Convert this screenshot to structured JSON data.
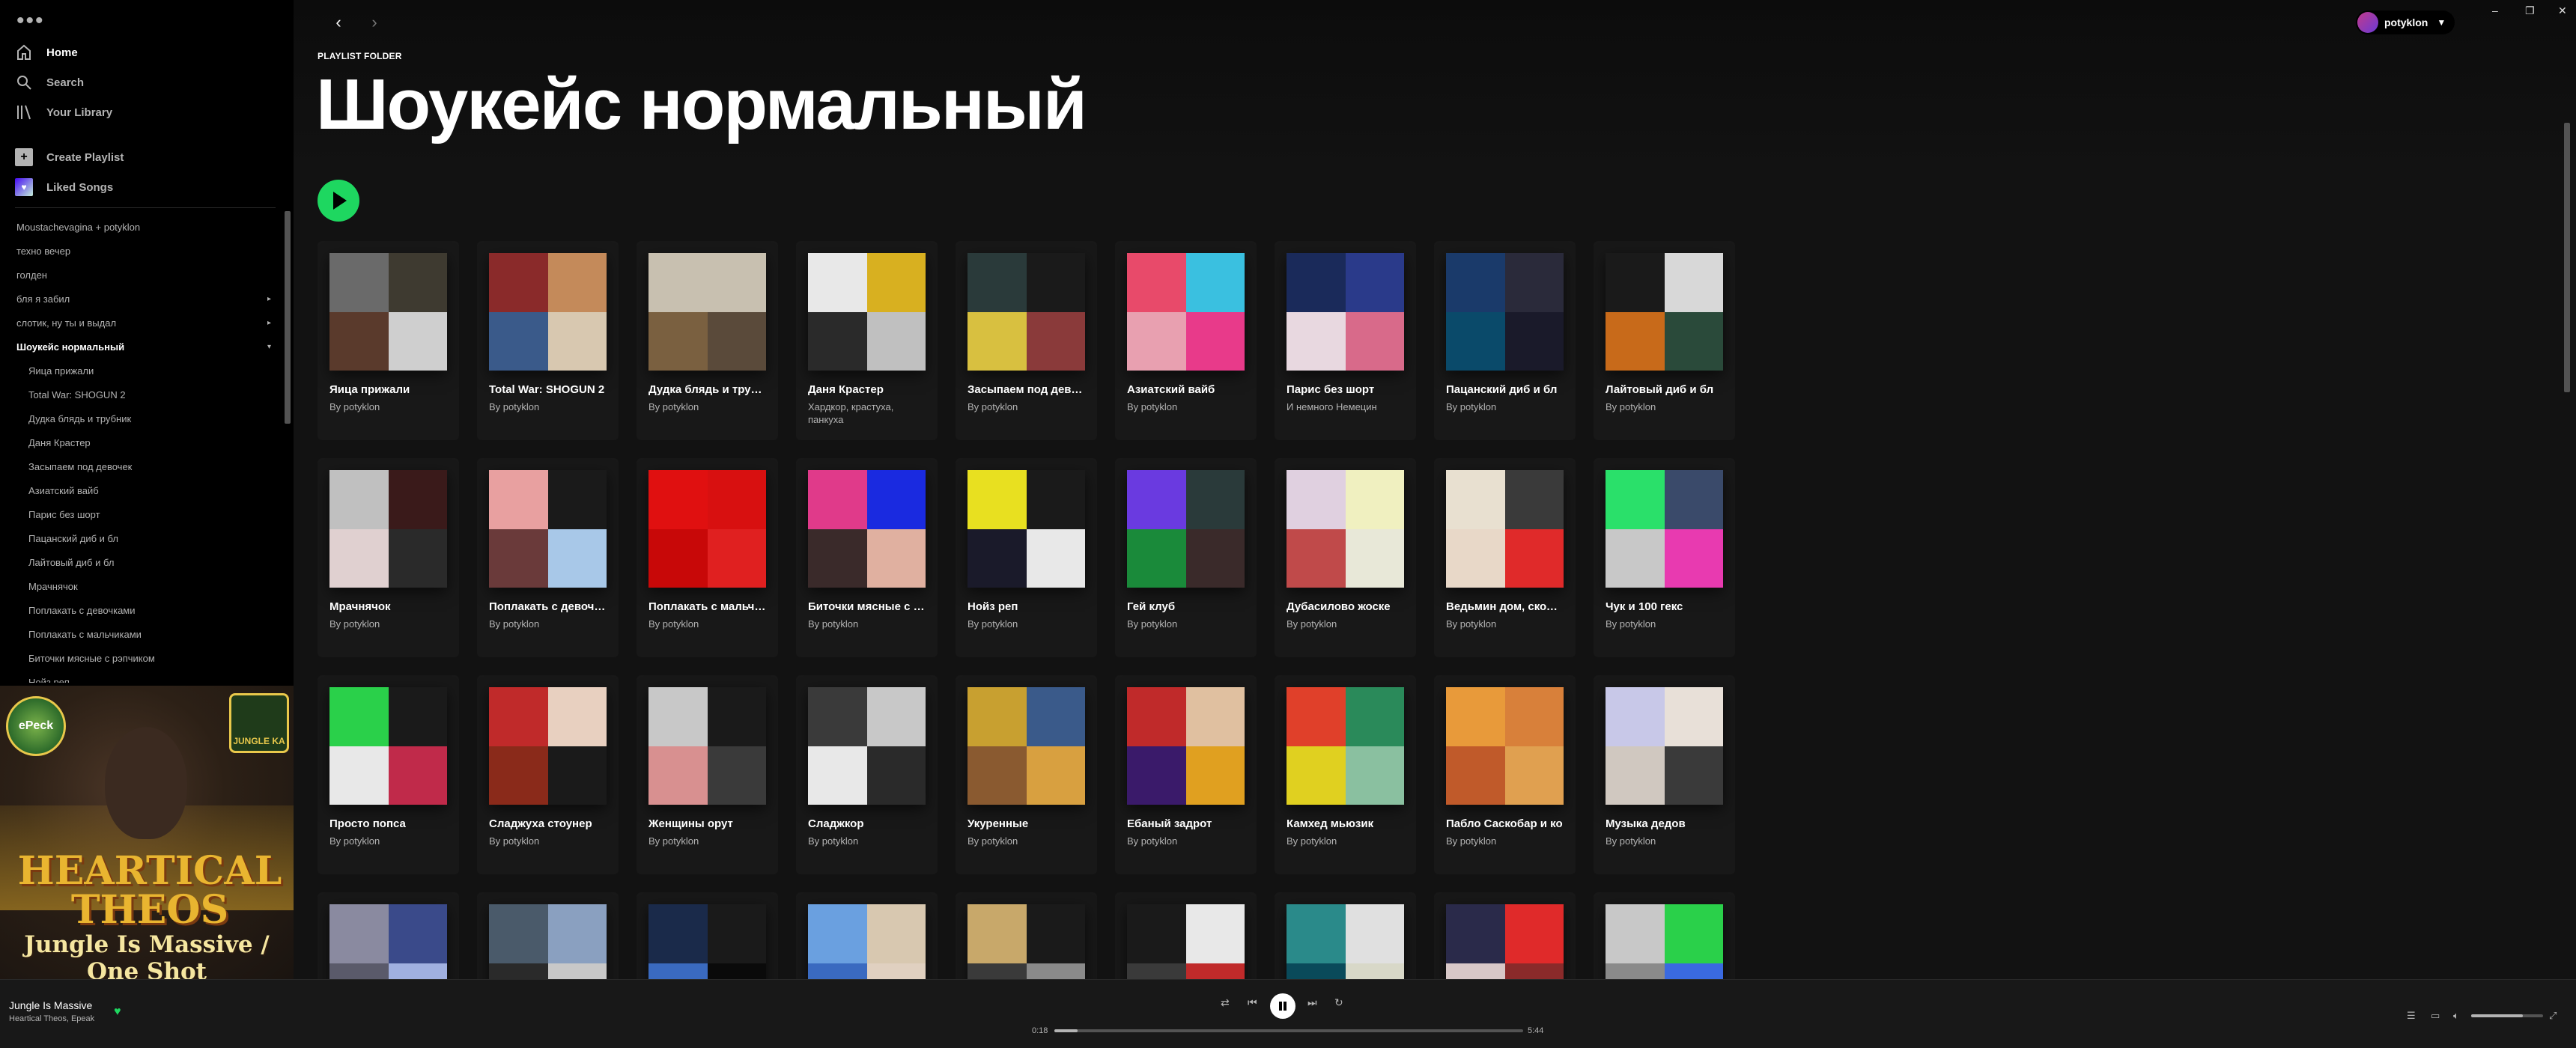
{
  "window": {
    "minimize": "–",
    "maximize": "❐",
    "close": "✕"
  },
  "sidebar": {
    "menu_icon": "•••",
    "nav": [
      {
        "label": "Home",
        "icon": "home-icon"
      },
      {
        "label": "Search",
        "icon": "search-icon"
      },
      {
        "label": "Your Library",
        "icon": "library-icon"
      }
    ],
    "create_playlist": "Create Playlist",
    "liked_songs": "Liked Songs",
    "playlists": [
      {
        "label": "Moustachevagina + potyklon",
        "level": 0
      },
      {
        "label": "техно вечер",
        "level": 0
      },
      {
        "label": "голден",
        "level": 0
      },
      {
        "label": "бля я забил",
        "level": 0,
        "caret": "▸"
      },
      {
        "label": "слотик, ну ты и выдал",
        "level": 0,
        "caret": "▸"
      },
      {
        "label": "Шоукейс нормальный",
        "level": 0,
        "caret": "▾",
        "open": true
      },
      {
        "label": "Яица прижали",
        "level": 1
      },
      {
        "label": "Total War: SHOGUN 2",
        "level": 1
      },
      {
        "label": "Дудка блядь и трубник",
        "level": 1
      },
      {
        "label": "Даня Крастер",
        "level": 1
      },
      {
        "label": "Засыпаем под девочек",
        "level": 1
      },
      {
        "label": "Азиатский вайб",
        "level": 1
      },
      {
        "label": "Парис без шорт",
        "level": 1
      },
      {
        "label": "Пацанский диб и бл",
        "level": 1
      },
      {
        "label": "Лайтовый диб и бл",
        "level": 1
      },
      {
        "label": "Мрачнячок",
        "level": 1
      },
      {
        "label": "Поплакать с девочками",
        "level": 1
      },
      {
        "label": "Поплакать с мальчиками",
        "level": 1
      },
      {
        "label": "Биточки мясные с рэпчиком",
        "level": 1
      },
      {
        "label": "Нойз реп",
        "level": 1
      }
    ],
    "album_art": {
      "logo_left": "ePeck",
      "logo_right": "JUNGLE KA",
      "title": "HEARTICAL THEOS",
      "subtitle": "Jungle Is Massive / One Shot"
    }
  },
  "topbar": {
    "back": "‹",
    "forward": "›",
    "user": "potyklon",
    "chevron": "▼"
  },
  "header": {
    "kind": "PLAYLIST FOLDER",
    "title": "Шоукейс нормальный"
  },
  "cards": [
    {
      "title": "Яица прижали",
      "sub": "By potyklon",
      "colors": [
        "#6a6a6a",
        "#3e3a30",
        "#5a3a2c",
        "#cfcfcf"
      ]
    },
    {
      "title": "Total War: SHOGUN 2",
      "sub": "By potyklon",
      "colors": [
        "#8a2a2a",
        "#c48a5a",
        "#3a5a8a",
        "#d8c8b0"
      ]
    },
    {
      "title": "Дудка блядь и трубник",
      "sub": "By potyklon",
      "colors": [
        "#c8c0b0",
        "#c8c0b0",
        "#7a6040",
        "#5a4a3a"
      ]
    },
    {
      "title": "Даня Крастер",
      "sub": "Хардкор, крастуха, панкуха",
      "colors": [
        "#e8e8e8",
        "#d8b020",
        "#2a2a2a",
        "#c0c0c0"
      ]
    },
    {
      "title": "Засыпаем под девочек",
      "sub": "By potyklon",
      "colors": [
        "#2a3a3a",
        "#1a1a1a",
        "#d8c040",
        "#8a3a3a"
      ]
    },
    {
      "title": "Азиатский вайб",
      "sub": "By potyklon",
      "colors": [
        "#e84a6a",
        "#3ac0e0",
        "#e8a0b0",
        "#e83a8a"
      ]
    },
    {
      "title": "Парис без шорт",
      "sub": "И немного Немецин",
      "colors": [
        "#1a2a5a",
        "#2a3a8a",
        "#e8d8e0",
        "#d86a8a"
      ]
    },
    {
      "title": "Пацанский диб и бл",
      "sub": "By potyklon",
      "colors": [
        "#1a3a6a",
        "#2a2a3a",
        "#0a4a6a",
        "#1a1a2a"
      ]
    },
    {
      "title": "Лайтовый диб и бл",
      "sub": "By potyklon",
      "colors": [
        "#1a1a1a",
        "#d8d8d8",
        "#c86a1a",
        "#2a4a3a"
      ]
    },
    {
      "title": "Мрачнячок",
      "sub": "By potyklon",
      "colors": [
        "#c0c0c0",
        "#3a1a1a",
        "#e0d0d0",
        "#2a2a2a"
      ]
    },
    {
      "title": "Поплакать с девочками",
      "sub": "By potyklon",
      "colors": [
        "#e8a0a0",
        "#1a1a1a",
        "#6a3a3a",
        "#a8c8e8"
      ]
    },
    {
      "title": "Поплакать с мальчиками",
      "sub": "By potyklon",
      "colors": [
        "#e01010",
        "#d81010",
        "#c80808",
        "#e02020"
      ]
    },
    {
      "title": "Биточки мясные с рэпчиком",
      "sub": "By potyklon",
      "colors": [
        "#e03a8a",
        "#1a2ae0",
        "#3a2a2a",
        "#e0b0a0"
      ]
    },
    {
      "title": "Нойз реп",
      "sub": "By potyklon",
      "colors": [
        "#e8e020",
        "#1a1a1a",
        "#1a1a2a",
        "#e8e8e8"
      ]
    },
    {
      "title": "Гей клуб",
      "sub": "By potyklon",
      "colors": [
        "#6a3ae0",
        "#2a3a3a",
        "#1a8a3a",
        "#3a2a2a"
      ]
    },
    {
      "title": "Дубасилово жоске",
      "sub": "By potyklon",
      "colors": [
        "#e0d0e0",
        "#f0f0c0",
        "#c04a4a",
        "#e8e8d8"
      ]
    },
    {
      "title": "Ведьмин дом, сколько лет",
      "sub": "By potyklon",
      "colors": [
        "#e8e0d0",
        "#3a3a3a",
        "#e8d8c8",
        "#e02a2a"
      ]
    },
    {
      "title": "Чук и 100 гекс",
      "sub": "By potyklon",
      "colors": [
        "#2ae06a",
        "#3a4a6a",
        "#c8c8c8",
        "#e83ab0"
      ]
    },
    {
      "title": "Просто попса",
      "sub": "By potyklon",
      "colors": [
        "#2ad04a",
        "#1a1a1a",
        "#e8e8e8",
        "#c02a4a"
      ]
    },
    {
      "title": "Сладжуха стоунер",
      "sub": "By potyklon",
      "colors": [
        "#c02a2a",
        "#e8d0c0",
        "#8a2a1a",
        "#1a1a1a"
      ]
    },
    {
      "title": "Женщины орут",
      "sub": "By potyklon",
      "colors": [
        "#c8c8c8",
        "#1a1a1a",
        "#d89090",
        "#3a3a3a"
      ]
    },
    {
      "title": "Сладжкор",
      "sub": "By potyklon",
      "colors": [
        "#3a3a3a",
        "#c8c8c8",
        "#e8e8e8",
        "#2a2a2a"
      ]
    },
    {
      "title": "Укуренные",
      "sub": "By potyklon",
      "colors": [
        "#c8a030",
        "#3a5a8a",
        "#8a5a30",
        "#d8a040"
      ]
    },
    {
      "title": "Ебаный задрот",
      "sub": "By potyklon",
      "colors": [
        "#c02a2a",
        "#e0c0a0",
        "#3a1a6a",
        "#e0a020"
      ]
    },
    {
      "title": "Камхед мьюзик",
      "sub": "By potyklon",
      "colors": [
        "#e0402a",
        "#2a8a5a",
        "#e0d020",
        "#8ac0a0"
      ]
    },
    {
      "title": "Пабло Саскобар и ко",
      "sub": "By potyklon",
      "colors": [
        "#e89a3a",
        "#d8803a",
        "#c05a2a",
        "#e0a050"
      ]
    },
    {
      "title": "Музыка дедов",
      "sub": "By potyklon",
      "colors": [
        "#c8c8e8",
        "#e8e0d8",
        "#d0c8c0",
        "#3a3a3a"
      ]
    },
    {
      "title": "",
      "sub": "",
      "colors": [
        "#8a8aa0",
        "#3a4a8a",
        "#5a5a6a",
        "#a0b0e0"
      ]
    },
    {
      "title": "",
      "sub": "",
      "colors": [
        "#4a5a6a",
        "#8aa0c0",
        "#2a2a2a",
        "#c8c8c8"
      ]
    },
    {
      "title": "",
      "sub": "",
      "colors": [
        "#1a2a4a",
        "#1a1a1a",
        "#3a6ac0",
        "#0a0a0a"
      ]
    },
    {
      "title": "",
      "sub": "",
      "colors": [
        "#6aa0e0",
        "#d8c8b0",
        "#3a6ac0",
        "#e0d0c0"
      ]
    },
    {
      "title": "",
      "sub": "",
      "colors": [
        "#c8a86a",
        "#1a1a1a",
        "#3a3a3a",
        "#8a8a8a"
      ]
    },
    {
      "title": "",
      "sub": "",
      "colors": [
        "#1a1a1a",
        "#e8e8e8",
        "#3a3a3a",
        "#c02a2a"
      ]
    },
    {
      "title": "",
      "sub": "",
      "colors": [
        "#2a8a8a",
        "#e0e0e0",
        "#0a4a5a",
        "#d8d8c8"
      ]
    },
    {
      "title": "",
      "sub": "",
      "colors": [
        "#2a2a4a",
        "#e02a2a",
        "#d8c8c8",
        "#8a2a2a"
      ]
    },
    {
      "title": "",
      "sub": "",
      "colors": [
        "#c8c8c8",
        "#2ad04a",
        "#8a8a8a",
        "#3a6ae0"
      ]
    }
  ],
  "player": {
    "track": "Jungle Is Massive",
    "artist": "Heartical Theos, Epeak",
    "time_now": "0:18",
    "time_end": "5:44",
    "progress": 0.05,
    "volume": 0.72,
    "icons": [
      "shuffle-icon",
      "previous-icon",
      "pause-icon",
      "next-icon",
      "repeat-icon",
      "queue-icon",
      "devices-icon",
      "volume-icon",
      "fullscreen-icon"
    ]
  }
}
